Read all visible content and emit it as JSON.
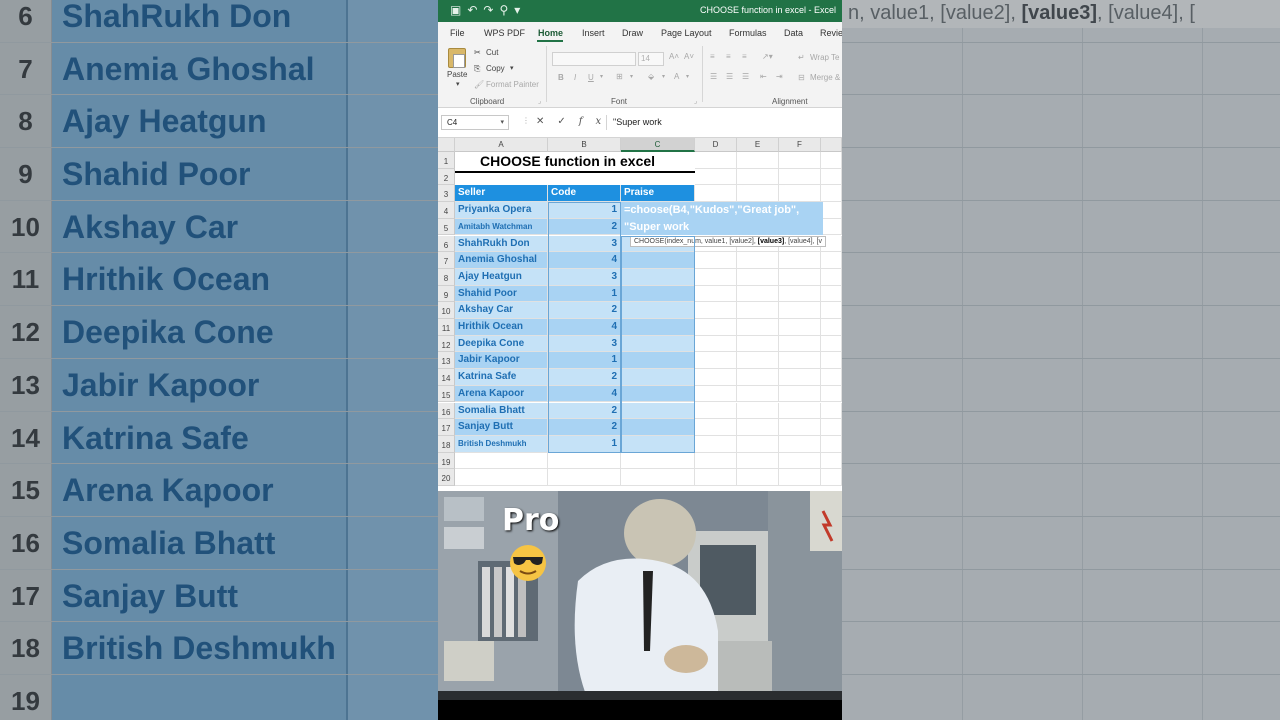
{
  "background": {
    "formula_hint": [
      "n, value1, [value2], ",
      "[value3]",
      ", [value4], ["
    ],
    "rows": [
      {
        "num": "6",
        "name": "ShahRukh Don"
      },
      {
        "num": "7",
        "name": "Anemia Ghoshal"
      },
      {
        "num": "8",
        "name": "Ajay Heatgun"
      },
      {
        "num": "9",
        "name": "Shahid Poor"
      },
      {
        "num": "10",
        "name": "Akshay Car"
      },
      {
        "num": "11",
        "name": "Hrithik Ocean"
      },
      {
        "num": "12",
        "name": "Deepika Cone"
      },
      {
        "num": "13",
        "name": "Jabir Kapoor"
      },
      {
        "num": "14",
        "name": "Katrina Safe"
      },
      {
        "num": "15",
        "name": "Arena Kapoor"
      },
      {
        "num": "16",
        "name": "Somalia Bhatt"
      },
      {
        "num": "17",
        "name": "Sanjay Butt"
      },
      {
        "num": "18",
        "name": "British Deshmukh"
      },
      {
        "num": "19",
        "name": ""
      }
    ]
  },
  "window": {
    "title": "CHOOSE function in excel  -  Excel",
    "accent": "#217346"
  },
  "menu": {
    "items": [
      "File",
      "WPS PDF",
      "Home",
      "Insert",
      "Draw",
      "Page Layout",
      "Formulas",
      "Data",
      "Revie"
    ],
    "active": "Home"
  },
  "ribbon": {
    "paste": "Paste",
    "cut": "Cut",
    "copy": "Copy",
    "format_painter": "Format Painter",
    "clipboard_label": "Clipboard",
    "font_label": "Font",
    "font_size": "14",
    "alignment_label": "Alignment",
    "wrap_text": "Wrap Te",
    "merge": "Merge &"
  },
  "formula_bar": {
    "name_box": "C4",
    "value": "\"Super work"
  },
  "sheet": {
    "title": "CHOOSE function in excel",
    "columns": [
      "A",
      "B",
      "C",
      "D",
      "E",
      "F"
    ],
    "row_numbers": [
      "1",
      "2",
      "3",
      "4",
      "5",
      "6",
      "7",
      "8",
      "9",
      "10",
      "11",
      "12",
      "13",
      "14",
      "15",
      "16",
      "17",
      "18",
      "19",
      "20"
    ],
    "headers": {
      "seller": "Seller",
      "code": "Code",
      "praise": "Praise"
    },
    "rows": [
      {
        "seller": "Priyanka Opera",
        "code": "1"
      },
      {
        "seller": "Amitabh Watchman",
        "code": "2",
        "small": true
      },
      {
        "seller": "ShahRukh Don",
        "code": "3"
      },
      {
        "seller": "Anemia Ghoshal",
        "code": "4"
      },
      {
        "seller": "Ajay Heatgun",
        "code": "3"
      },
      {
        "seller": "Shahid Poor",
        "code": "1"
      },
      {
        "seller": "Akshay Car",
        "code": "2"
      },
      {
        "seller": "Hrithik Ocean",
        "code": "4"
      },
      {
        "seller": "Deepika Cone",
        "code": "3"
      },
      {
        "seller": "Jabir Kapoor",
        "code": "1"
      },
      {
        "seller": "Katrina Safe",
        "code": "2"
      },
      {
        "seller": "Arena Kapoor",
        "code": "4"
      },
      {
        "seller": "Somalia Bhatt",
        "code": "2"
      },
      {
        "seller": "Sanjay Butt",
        "code": "2"
      },
      {
        "seller": "British Deshmukh",
        "code": "1",
        "small": true
      }
    ],
    "edit_line1": "=choose(B4,\"Kudos\",\"Great job\",",
    "edit_line2": "\"Super work",
    "tooltip": [
      "CHOOSE(index_num, value1, [value2], ",
      "[value3]",
      ", [value4], [v"
    ]
  },
  "meme": {
    "caption": "Pro"
  }
}
